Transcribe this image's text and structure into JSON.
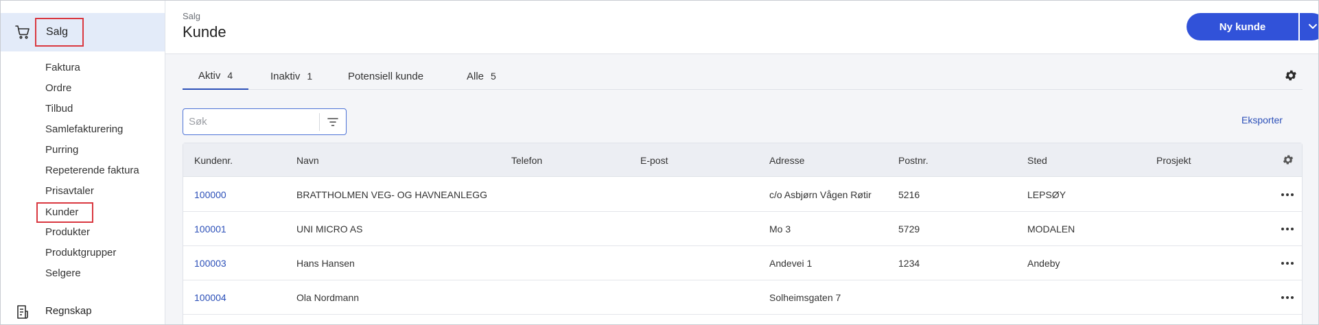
{
  "sidebar": {
    "group_label": "Salg",
    "items": [
      {
        "label": "Faktura"
      },
      {
        "label": "Ordre"
      },
      {
        "label": "Tilbud"
      },
      {
        "label": "Samlefakturering"
      },
      {
        "label": "Purring"
      },
      {
        "label": "Repeterende faktura"
      },
      {
        "label": "Prisavtaler"
      },
      {
        "label": "Kunder"
      },
      {
        "label": "Produkter"
      },
      {
        "label": "Produktgrupper"
      },
      {
        "label": "Selgere"
      }
    ],
    "next_group_label": "Regnskap"
  },
  "header": {
    "breadcrumb": "Salg",
    "title": "Kunde",
    "new_button_label": "Ny kunde"
  },
  "tabs": [
    {
      "label": "Aktiv",
      "count": "4"
    },
    {
      "label": "Inaktiv",
      "count": "1"
    },
    {
      "label": "Potensiell kunde",
      "count": ""
    },
    {
      "label": "Alle",
      "count": "5"
    }
  ],
  "search": {
    "placeholder": "Søk",
    "value": ""
  },
  "export_label": "Eksporter",
  "table": {
    "columns": [
      "Kundenr.",
      "Navn",
      "Telefon",
      "E-post",
      "Adresse",
      "Postnr.",
      "Sted",
      "Prosjekt"
    ],
    "rows": [
      {
        "kundenr": "100000",
        "navn": "BRATTHOLMEN VEG- OG HAVNEANLEGG",
        "telefon": "",
        "epost": "",
        "adresse": "c/o Asbjørn Vågen Røtir",
        "postnr": "5216",
        "sted": "LEPSØY",
        "prosjekt": ""
      },
      {
        "kundenr": "100001",
        "navn": "UNI MICRO AS",
        "telefon": "",
        "epost": "",
        "adresse": "Mo 3",
        "postnr": "5729",
        "sted": "MODALEN",
        "prosjekt": ""
      },
      {
        "kundenr": "100003",
        "navn": "Hans Hansen",
        "telefon": "",
        "epost": "",
        "adresse": "Andevei 1",
        "postnr": "1234",
        "sted": "Andeby",
        "prosjekt": ""
      },
      {
        "kundenr": "100004",
        "navn": "Ola Nordmann",
        "telefon": "",
        "epost": "",
        "adresse": "Solheimsgaten 7",
        "postnr": "",
        "sted": "",
        "prosjekt": ""
      }
    ]
  },
  "colors": {
    "accent": "#3152d9",
    "link": "#2b4fb8",
    "highlight_border": "#d9373f",
    "sidebar_active_bg": "#e3ebf9"
  },
  "icons": {
    "sales": "cart-icon",
    "accounting": "document-icon",
    "settings": "gear-icon",
    "filter": "filter-icon",
    "row_actions": "more-horizontal-icon",
    "dropdown": "chevron-down-icon"
  }
}
